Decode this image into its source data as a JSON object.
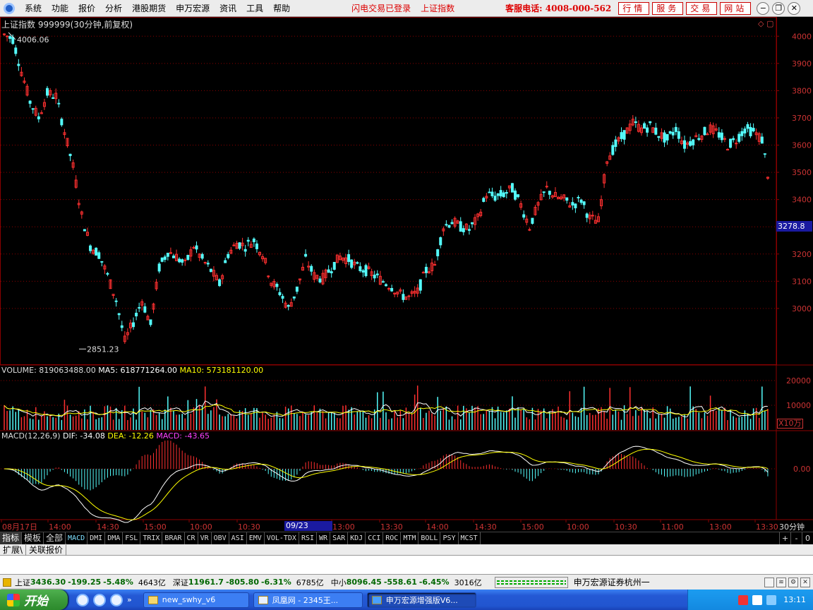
{
  "menubar": {
    "items": [
      "系统",
      "功能",
      "报价",
      "分析",
      "港股期货",
      "申万宏源",
      "资讯",
      "工具",
      "帮助"
    ],
    "status": "闪电交易已登录",
    "index_link": "上证指数",
    "hotline": "客服电话: 4008-000-562",
    "buttons": [
      "行情",
      "服务",
      "交易",
      "网站"
    ]
  },
  "chart": {
    "title": "上证指数 999999(30分钟,前复权)",
    "price_high_label": "4006.06",
    "price_low_label": "2851.23",
    "current_price": "3278.8",
    "y_ticks": [
      "4000",
      "3900",
      "3800",
      "3700",
      "3600",
      "3500",
      "3400",
      "3300",
      "3200",
      "3100",
      "3000"
    ],
    "volume_title": {
      "label": "VOLUME: 819063488.00",
      "ma5": "MA5: 618771264.00",
      "ma10": "MA10: 573181120.00"
    },
    "volume_ticks": [
      "20000",
      "10000"
    ],
    "volume_unit": "X10万",
    "macd_title": {
      "label": "MACD(12,26,9)",
      "dif": "DIF: -34.08",
      "dea": "DEA: -12.26",
      "macd": "MACD: -43.65"
    },
    "macd_zero": "0.00",
    "time_labels": [
      "08月17日",
      "14:00",
      "14:30",
      "15:00",
      "10:00",
      "10:30",
      "11:00",
      "13:00",
      "13:30",
      "14:00",
      "14:30",
      "15:00",
      "10:00",
      "10:30",
      "11:00",
      "13:00",
      "13:30"
    ],
    "cursor_time": "09/23 13:00",
    "period": "30分钟",
    "colors": {
      "up": "#ff3030",
      "down": "#54fcfc",
      "grid": "#8b0000",
      "ma5": "#ffffff",
      "ma10": "#ffff00",
      "macd": "#ff00ff",
      "badge": "#1a1aa0"
    }
  },
  "chart_data": {
    "type": "candlestick",
    "series_close_approx": [
      4006,
      3990,
      3870,
      3760,
      3700,
      3790,
      3780,
      3650,
      3520,
      3340,
      3230,
      3200,
      3120,
      3030,
      2880,
      2950,
      3030,
      2940,
      3150,
      3210,
      3190,
      3160,
      3230,
      3180,
      3140,
      3090,
      3200,
      3240,
      3230,
      3250,
      3200,
      3100,
      3060,
      3000,
      3070,
      3180,
      3120,
      3110,
      3150,
      3190,
      3180,
      3150,
      3140,
      3120,
      3100,
      3080,
      3050,
      3040,
      3060,
      3140,
      3160,
      3300,
      3320,
      3300,
      3290,
      3330,
      3420,
      3410,
      3420,
      3440,
      3380,
      3300,
      3380,
      3440,
      3410,
      3400,
      3380,
      3400,
      3330,
      3320,
      3550,
      3600,
      3640,
      3680,
      3660,
      3670,
      3640,
      3620,
      3660,
      3600,
      3620,
      3640,
      3660,
      3640,
      3600,
      3620,
      3660,
      3650,
      3620,
      3430
    ],
    "y_range": [
      2800,
      4050
    ]
  },
  "tabs": {
    "big": [
      "指标",
      "模板",
      "全部"
    ],
    "indicators": [
      "MACD",
      "DMI",
      "DMA",
      "FSL",
      "TRIX",
      "BRAR",
      "CR",
      "VR",
      "OBV",
      "ASI",
      "EMV",
      "VOL-TDX",
      "RSI",
      "WR",
      "SAR",
      "KDJ",
      "CCI",
      "ROC",
      "MTM",
      "BOLL",
      "PSY",
      "MCST"
    ],
    "controls": [
      "+",
      "-",
      "0"
    ]
  },
  "ext_tabs": [
    "扩展\\",
    "关联报价"
  ],
  "statusbar": {
    "markets": [
      {
        "name": "上证",
        "value": "3436.30",
        "chg": "-199.25",
        "pct": "-5.48%",
        "amt": "4643亿"
      },
      {
        "name": "深证",
        "value": "11961.7",
        "chg": "-805.80",
        "pct": "-6.31%",
        "amt": "6785亿"
      },
      {
        "name": "中小",
        "value": "8096.45",
        "chg": "-558.61",
        "pct": "-6.45%",
        "amt": "3016亿"
      }
    ],
    "broker": "申万宏源证券杭州一"
  },
  "taskbar": {
    "start": "开始",
    "tasks": [
      "new_swhy_v6",
      "凤凰网 - 2345王...",
      "申万宏源增强版V6..."
    ],
    "clock": "13:11"
  }
}
